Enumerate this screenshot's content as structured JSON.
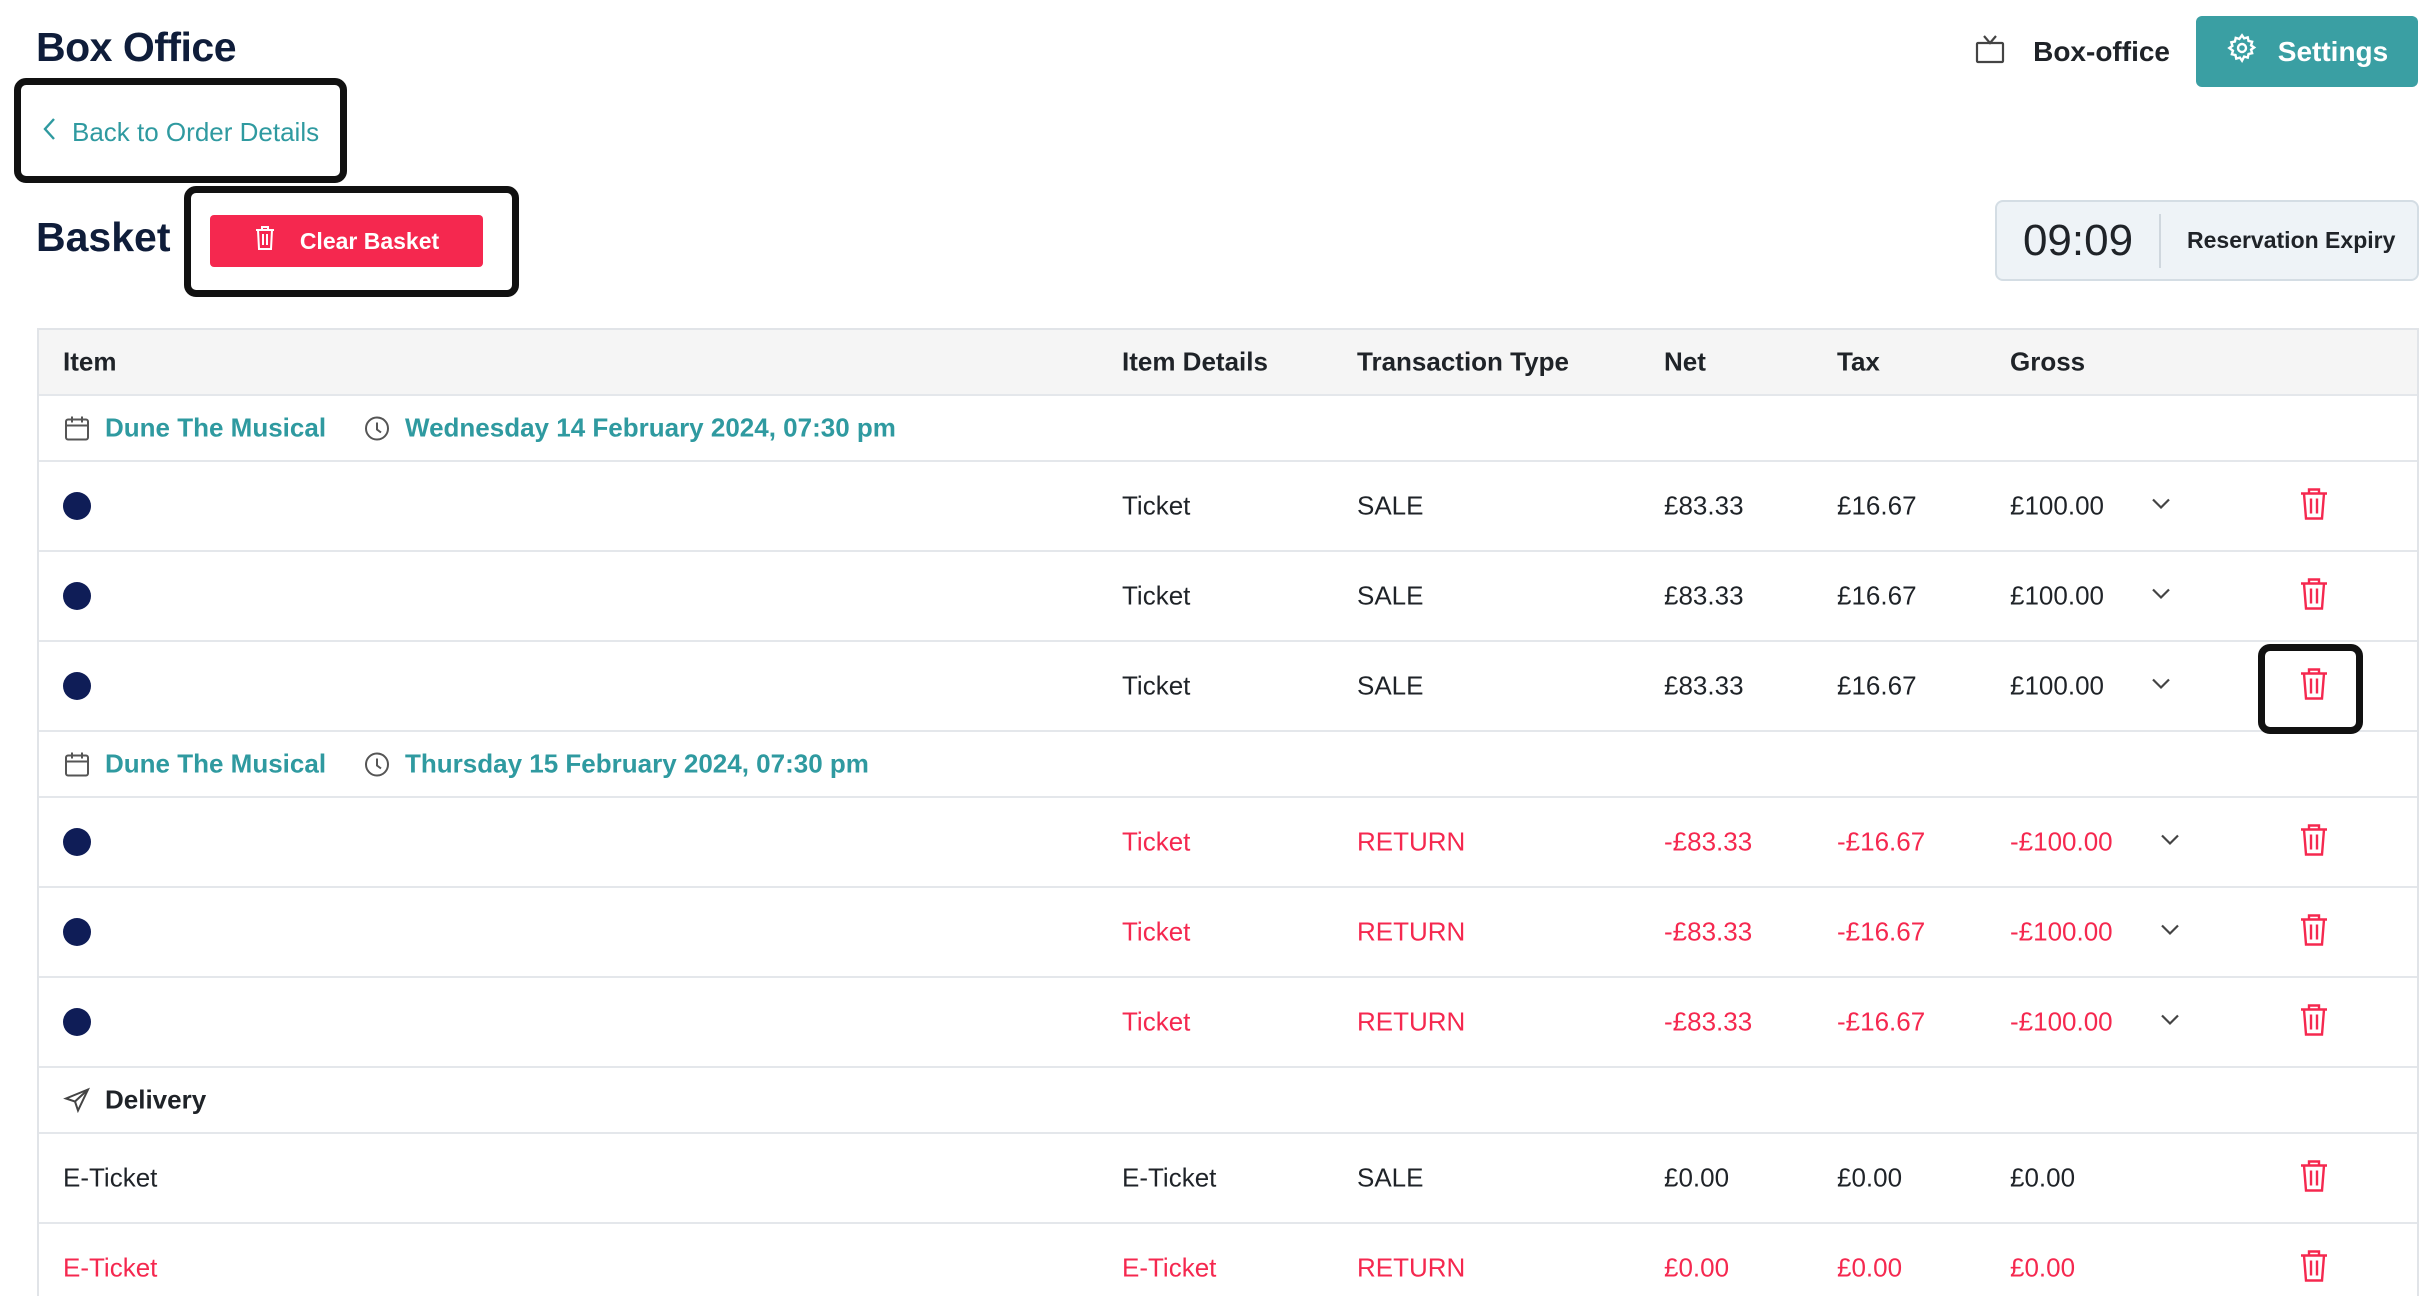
{
  "header": {
    "title": "Box Office",
    "box_office_label": "Box-office",
    "settings_label": "Settings"
  },
  "nav": {
    "back_label": "Back to Order Details"
  },
  "basket": {
    "title": "Basket",
    "clear_label": "Clear Basket"
  },
  "reservation": {
    "time": "09:09",
    "label": "Reservation Expiry"
  },
  "table": {
    "headers": {
      "item": "Item",
      "details": "Item Details",
      "type": "Transaction Type",
      "net": "Net",
      "tax": "Tax",
      "gross": "Gross"
    },
    "groups": [
      {
        "event": "Dune The Musical",
        "datetime": "Wednesday 14 February 2024, 07:30 pm",
        "rows": [
          {
            "details": "Ticket",
            "type": "SALE",
            "net": "£83.33",
            "tax": "£16.67",
            "gross": "£100.00"
          },
          {
            "details": "Ticket",
            "type": "SALE",
            "net": "£83.33",
            "tax": "£16.67",
            "gross": "£100.00"
          },
          {
            "details": "Ticket",
            "type": "SALE",
            "net": "£83.33",
            "tax": "£16.67",
            "gross": "£100.00"
          }
        ]
      },
      {
        "event": "Dune The Musical",
        "datetime": "Thursday 15 February 2024, 07:30 pm",
        "rows": [
          {
            "details": "Ticket",
            "type": "RETURN",
            "net": "-£83.33",
            "tax": "-£16.67",
            "gross": "-£100.00"
          },
          {
            "details": "Ticket",
            "type": "RETURN",
            "net": "-£83.33",
            "tax": "-£16.67",
            "gross": "-£100.00"
          },
          {
            "details": "Ticket",
            "type": "RETURN",
            "net": "-£83.33",
            "tax": "-£16.67",
            "gross": "-£100.00"
          }
        ]
      }
    ],
    "delivery": {
      "label": "Delivery",
      "rows": [
        {
          "item": "E-Ticket",
          "details": "E-Ticket",
          "type": "SALE",
          "net": "£0.00",
          "tax": "£0.00",
          "gross": "£0.00"
        },
        {
          "item": "E-Ticket",
          "details": "E-Ticket",
          "type": "RETURN",
          "net": "£0.00",
          "tax": "£0.00",
          "gross": "£0.00"
        }
      ]
    }
  },
  "colors": {
    "accent": "#3a9fa3",
    "danger": "#f5284f",
    "navy": "#0f1d3a",
    "dot": "#0f1d57"
  },
  "icons": {
    "box_office": "tv-icon",
    "settings": "gear-icon",
    "back": "chevron-left-icon",
    "clear": "trash-icon",
    "event": "calendar-icon",
    "time": "clock-icon",
    "delivery": "send-icon",
    "expand": "chevron-down-icon",
    "delete": "trash-icon"
  }
}
